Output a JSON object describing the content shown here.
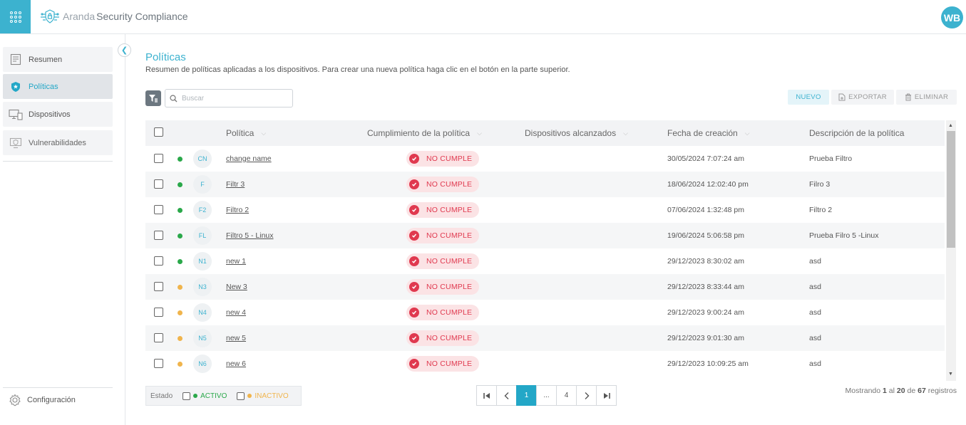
{
  "header": {
    "brand_aranda": "Aranda",
    "brand_product": "Security Compliance",
    "user_initials": "WB"
  },
  "sidebar": {
    "items": [
      {
        "label": "Resumen",
        "icon": "summary-icon"
      },
      {
        "label": "Políticas",
        "icon": "shield-star-icon"
      },
      {
        "label": "Dispositivos",
        "icon": "devices-icon"
      },
      {
        "label": "Vulnerabilidades",
        "icon": "vulnerability-icon"
      }
    ],
    "config_label": "Configuración"
  },
  "main": {
    "title": "Políticas",
    "subtitle": "Resumen de políticas aplicadas a los dispositivos. Para crear una nueva política haga clic en el botón en la parte superior.",
    "search_placeholder": "Buscar",
    "actions": {
      "nuevo": "NUEVO",
      "exportar": "EXPORTAR",
      "eliminar": "ELIMINAR"
    }
  },
  "table": {
    "columns": {
      "policy": "Política",
      "compliance": "Cumplimiento de la política",
      "devices": "Dispositivos alcanzados",
      "created": "Fecha de creación",
      "description": "Descripción de la política"
    },
    "rows": [
      {
        "status": "active",
        "initials": "CN",
        "name": "change name",
        "compliance": "NO CUMPLE",
        "created": "30/05/2024 7:07:24 am",
        "description": "Prueba Filtro"
      },
      {
        "status": "active",
        "initials": "F",
        "name": "Filtr 3",
        "compliance": "NO CUMPLE",
        "created": "18/06/2024 12:02:40 pm",
        "description": "Filro 3"
      },
      {
        "status": "active",
        "initials": "F2",
        "name": "Filtro 2",
        "compliance": "NO CUMPLE",
        "created": "07/06/2024 1:32:48 pm",
        "description": "Filtro 2"
      },
      {
        "status": "active",
        "initials": "FL",
        "name": "Filtro 5 - Linux",
        "compliance": "NO CUMPLE",
        "created": "19/06/2024 5:06:58 pm",
        "description": "Prueba Filro 5 -Linux"
      },
      {
        "status": "active",
        "initials": "N1",
        "name": "new 1",
        "compliance": "NO CUMPLE",
        "created": "29/12/2023 8:30:02 am",
        "description": "asd"
      },
      {
        "status": "inactive",
        "initials": "N3",
        "name": "New 3",
        "compliance": "NO CUMPLE",
        "created": "29/12/2023 8:33:44 am",
        "description": "asd"
      },
      {
        "status": "inactive",
        "initials": "N4",
        "name": "new 4",
        "compliance": "NO CUMPLE",
        "created": "29/12/2023 9:00:24 am",
        "description": "asd"
      },
      {
        "status": "inactive",
        "initials": "N5",
        "name": "new 5",
        "compliance": "NO CUMPLE",
        "created": "29/12/2023 9:01:30 am",
        "description": "asd"
      },
      {
        "status": "inactive",
        "initials": "N6",
        "name": "new 6",
        "compliance": "NO CUMPLE",
        "created": "29/12/2023 10:09:25 am",
        "description": "asd"
      }
    ]
  },
  "footer": {
    "state_label": "Estado",
    "active_label": "ACTIVO",
    "inactive_label": "INACTIVO",
    "pages": [
      "1",
      "...",
      "4"
    ],
    "current_page": "1",
    "info_prefix": "Mostrando",
    "info_from": "1",
    "info_al": "al",
    "info_to": "20",
    "info_de": "de",
    "info_total": "67",
    "info_suffix": "registros"
  },
  "colors": {
    "accent": "#3cb2cf",
    "active": "#2aa84a",
    "inactive": "#f0b44c",
    "no_cumple": "#e0394f"
  }
}
